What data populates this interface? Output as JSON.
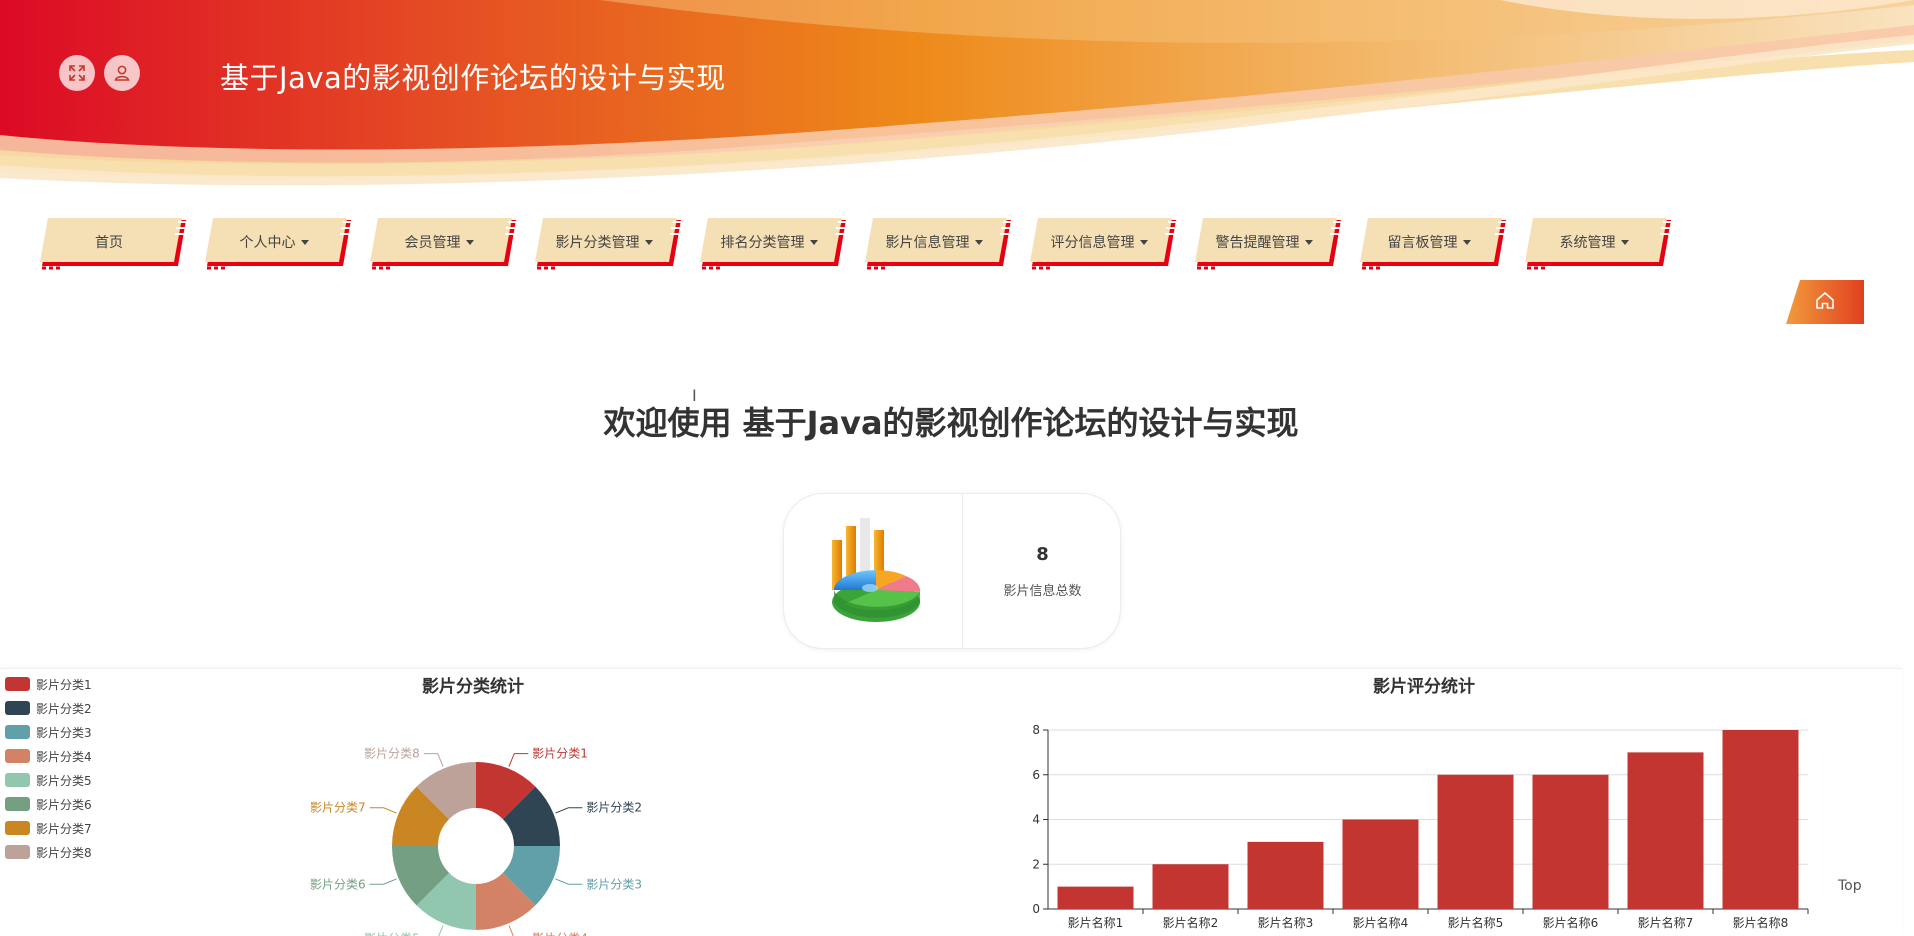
{
  "header": {
    "site_title": "基于Java的影视创作论坛的设计与实现",
    "icons": [
      "fullscreen-icon",
      "user-icon"
    ]
  },
  "nav": {
    "items": [
      {
        "label": "首页",
        "dropdown": false
      },
      {
        "label": "个人中心",
        "dropdown": true
      },
      {
        "label": "会员管理",
        "dropdown": true
      },
      {
        "label": "影片分类管理",
        "dropdown": true
      },
      {
        "label": "排名分类管理",
        "dropdown": true
      },
      {
        "label": "影片信息管理",
        "dropdown": true
      },
      {
        "label": "评分信息管理",
        "dropdown": true
      },
      {
        "label": "警告提醒管理",
        "dropdown": true
      },
      {
        "label": "留言板管理",
        "dropdown": true
      },
      {
        "label": "系统管理",
        "dropdown": true
      }
    ],
    "home_icon": "home-icon"
  },
  "welcome": "欢迎使用 基于Java的影视创作论坛的设计与实现",
  "stat": {
    "value": "8",
    "label": "影片信息总数"
  },
  "top_link": "Top",
  "colors": {
    "accent_red": "#e60012",
    "nav_bg": "#f5dfb4",
    "bar": "#c23531"
  },
  "chart_data": [
    {
      "type": "pie",
      "title": "影片分类统计",
      "categories": [
        "影片分类1",
        "影片分类2",
        "影片分类3",
        "影片分类4",
        "影片分类5",
        "影片分类6",
        "影片分类7",
        "影片分类8"
      ],
      "values": [
        1,
        1,
        1,
        1,
        1,
        1,
        1,
        1
      ],
      "colors": [
        "#c23531",
        "#2f4554",
        "#61a0a8",
        "#d48265",
        "#91c7ae",
        "#749f83",
        "#ca8622",
        "#bda29a"
      ],
      "legend_position": "left",
      "donut": true
    },
    {
      "type": "bar",
      "title": "影片评分统计",
      "categories": [
        "影片名称1",
        "影片名称2",
        "影片名称3",
        "影片名称4",
        "影片名称5",
        "影片名称6",
        "影片名称7",
        "影片名称8"
      ],
      "values": [
        1,
        2,
        3,
        4,
        6,
        6,
        7,
        8
      ],
      "yticks": [
        0,
        2,
        4,
        6,
        8
      ],
      "ylim": [
        0,
        8
      ],
      "grid": true,
      "color": "#c23531"
    }
  ]
}
